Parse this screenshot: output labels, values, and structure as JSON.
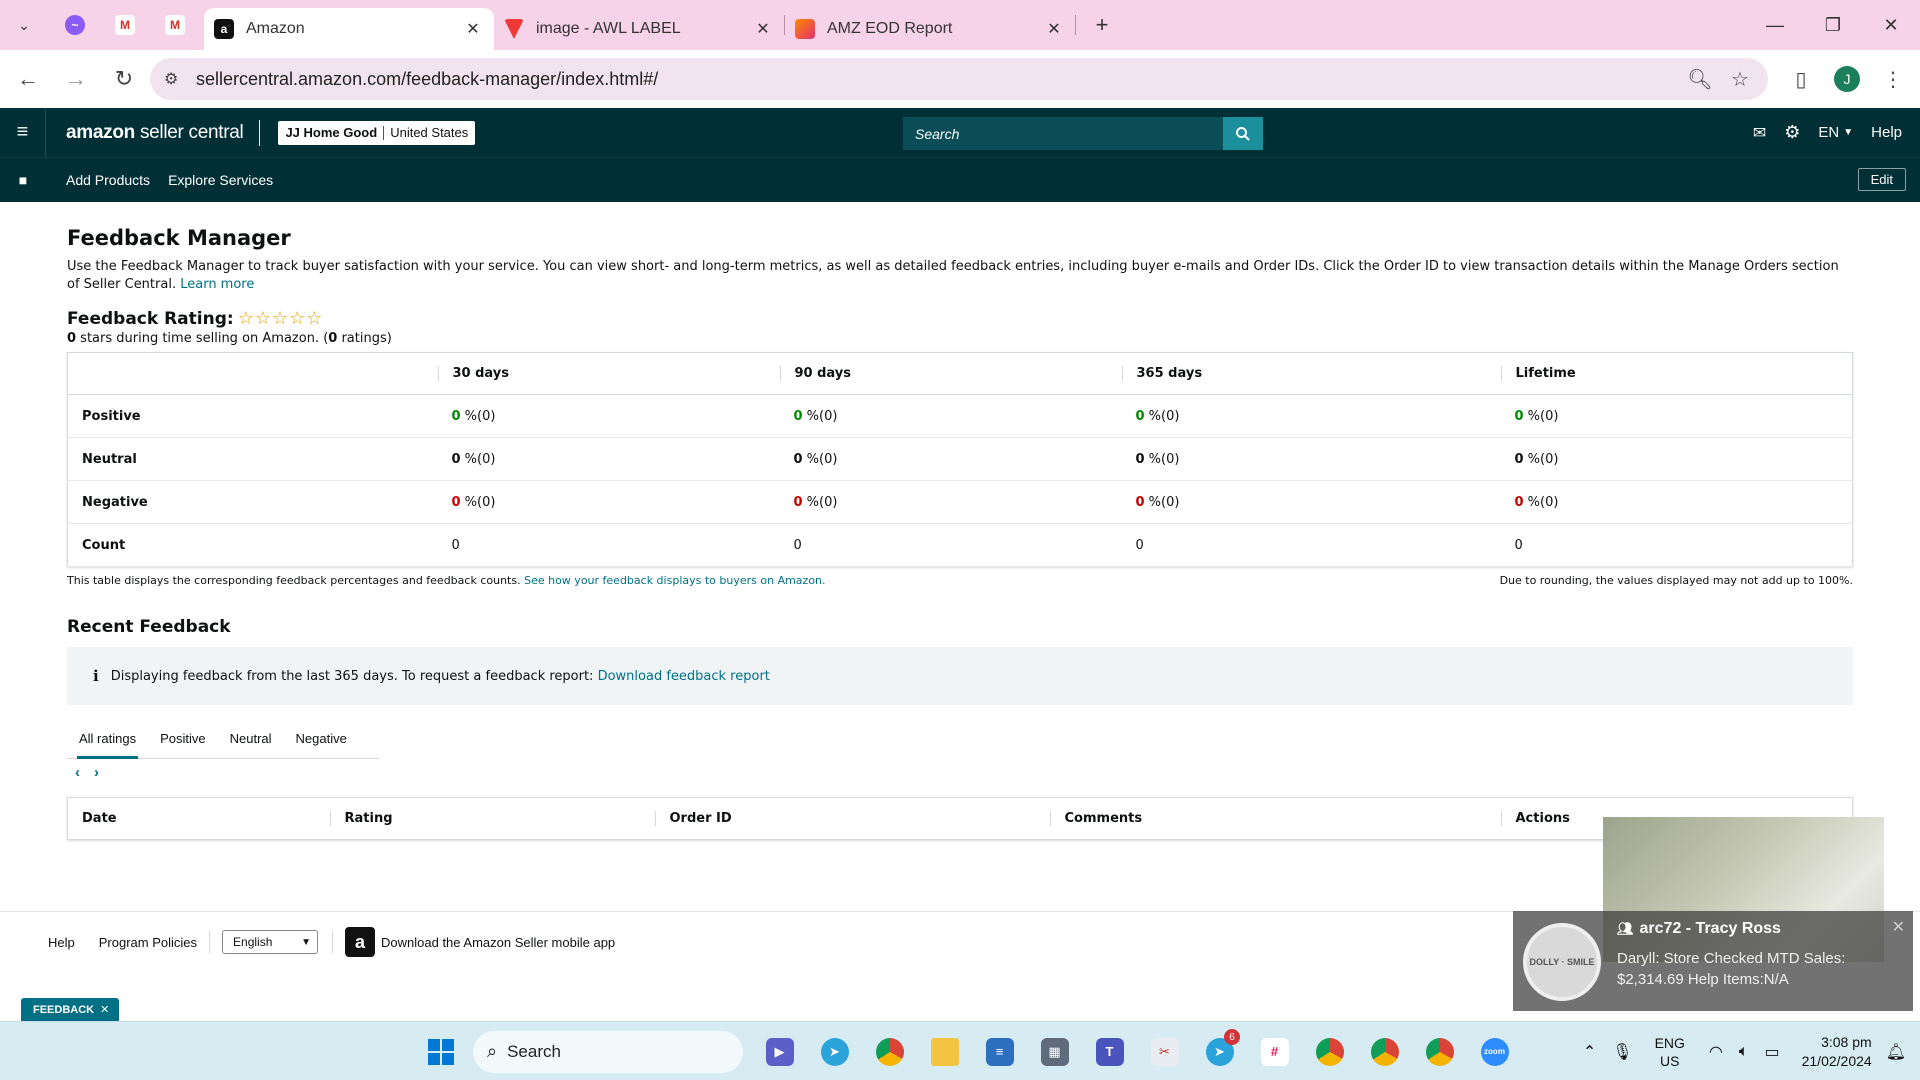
{
  "browser": {
    "tabs": [
      {
        "title": "Amazon",
        "icon": "amazon-icon",
        "active": true
      },
      {
        "title": "image - AWL LABEL",
        "icon": "vivaldi-icon",
        "active": false
      },
      {
        "title": "AMZ EOD Report",
        "icon": "app-icon",
        "active": false
      }
    ],
    "url": "sellercentral.amazon.com/feedback-manager/index.html#/",
    "profile_initial": "J"
  },
  "header": {
    "logo_brand": "amazon",
    "logo_product": "seller central",
    "store_name": "JJ Home Good",
    "store_marketplace": "United States",
    "search_placeholder": "Search",
    "language": "EN",
    "help": "Help",
    "nav_links": [
      "Add Products",
      "Explore Services"
    ],
    "edit": "Edit"
  },
  "main": {
    "title": "Feedback Manager",
    "description": "Use the Feedback Manager to track buyer satisfaction with your service. You can view short- and long-term metrics, as well as detailed feedback entries, including buyer e-mails and Order IDs. Click the Order ID to view transaction details within the Manage Orders section of Seller Central.",
    "learn_more": "Learn more",
    "rating_label": "Feedback Rating:",
    "rating_stars": "☆☆☆☆☆",
    "stars_count": "0",
    "stars_text": " stars during time selling on Amazon. (",
    "ratings_count": "0",
    "ratings_text": " ratings)",
    "table": {
      "columns": [
        "",
        "30 days",
        "90 days",
        "365 days",
        "Lifetime"
      ],
      "rows": [
        {
          "label": "Positive",
          "cells": [
            {
              "v": "0",
              "suffix": " %(0)"
            },
            {
              "v": "0",
              "suffix": " %(0)"
            },
            {
              "v": "0",
              "suffix": " %(0)"
            },
            {
              "v": "0",
              "suffix": " %(0)"
            }
          ]
        },
        {
          "label": "Neutral",
          "cells": [
            {
              "v": "0",
              "suffix": " %(0)"
            },
            {
              "v": "0",
              "suffix": " %(0)"
            },
            {
              "v": "0",
              "suffix": " %(0)"
            },
            {
              "v": "0",
              "suffix": " %(0)"
            }
          ]
        },
        {
          "label": "Negative",
          "cells": [
            {
              "v": "0",
              "suffix": " %(0)"
            },
            {
              "v": "0",
              "suffix": " %(0)"
            },
            {
              "v": "0",
              "suffix": " %(0)"
            },
            {
              "v": "0",
              "suffix": " %(0)"
            }
          ]
        },
        {
          "label": "Count",
          "cells": [
            {
              "v": "0"
            },
            {
              "v": "0"
            },
            {
              "v": "0"
            },
            {
              "v": "0"
            }
          ]
        }
      ]
    },
    "note_left": "This table displays the corresponding feedback percentages and feedback counts.",
    "note_link": "See how your feedback displays to buyers on Amazon.",
    "note_right": "Due to rounding, the values displayed may not add up to 100%.",
    "recent_title": "Recent Feedback",
    "info_text": "Displaying feedback from the last 365 days. To request a feedback report:",
    "info_link": "Download feedback report",
    "filter_tabs": [
      "All ratings",
      "Positive",
      "Neutral",
      "Negative"
    ],
    "recent_columns": [
      "Date",
      "Rating",
      "Order ID",
      "Comments",
      "Actions"
    ]
  },
  "footer": {
    "links": [
      "Help",
      "Program Policies"
    ],
    "language_select": "English",
    "app_text": "Download the Amazon Seller mobile app",
    "feedback_tab": "FEEDBACK"
  },
  "notification": {
    "title": "arc72 - Tracy Ross",
    "message": "Daryll: Store Checked MTD Sales: $2,314.69 Help Items:N/A"
  },
  "taskbar": {
    "search": "Search",
    "telegram_badge": "6",
    "lang_line1": "ENG",
    "lang_line2": "US",
    "time": "3:08 pm",
    "date": "21/02/2024"
  },
  "colors": {
    "header_bg": "#002f36",
    "link": "#007185",
    "positive": "#008a00",
    "negative": "#c40000",
    "tabstrip_bg": "#f6d3e8"
  }
}
